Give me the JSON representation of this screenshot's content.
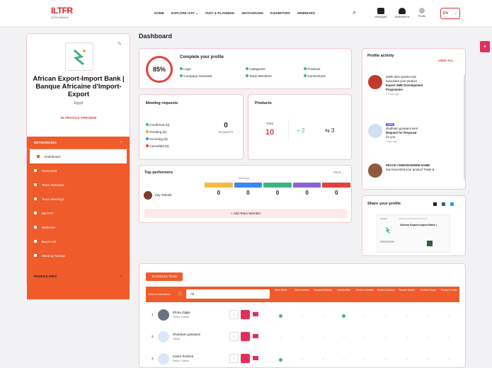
{
  "topbar": {
    "logo_text": "ILTFR",
    "logo_sub": "AFREXIMBANK",
    "nav": [
      "HOME",
      "EXPLORE IATF",
      "VISIT & PLANNING",
      "INSTAGRAMS",
      "EXHIBITORS",
      "WEBINARS"
    ],
    "nav_dropdown_index": 1,
    "icons": [
      {
        "label": "Messages"
      },
      {
        "label": "Notifications"
      },
      {
        "label": "Profile"
      }
    ],
    "lang": "EN"
  },
  "sidebar": {
    "org_name": "African Export-Import Bank | Banque Africaine d'Import-Export",
    "org_country": "Egypt",
    "preview_link": "IN PROFILE PREVIEW",
    "section_label": "NETWORKING",
    "menu": [
      "Dashboard",
      "Favourites",
      "Team Schedule",
      "Team Meetings",
      "My RFP",
      "Webinars",
      "Buyer List",
      "Meeting Ratings"
    ],
    "profile_info": "PROFILE INFO"
  },
  "main": {
    "title": "Dashboard",
    "profile": {
      "percent": "85%",
      "title": "Complete your profile",
      "items": [
        "Logo",
        "Company Overview",
        "Categories",
        "Team Members",
        "Products",
        "Connections"
      ]
    },
    "meetings": {
      "title": "Meeting requests",
      "items": [
        {
          "label": "Confirmed (0)",
          "color": "#3bb77e"
        },
        {
          "label": "Pending (0)",
          "color": "#f2a33a"
        },
        {
          "label": "Incoming (0)",
          "color": "#3a86f2"
        },
        {
          "label": "Cancelled (0)",
          "color": "#e2433a"
        }
      ],
      "count": "0",
      "count_label": "REQUESTS"
    },
    "products": {
      "title": "Products",
      "total_label": "Total",
      "total": "10",
      "a": "2",
      "b": "3"
    },
    "performers": {
      "title": "Top performers",
      "filter": "Week",
      "meetings_label": "Meetings",
      "person": "Kay Yeboah",
      "values": [
        "0",
        "0",
        "0",
        "0",
        "0"
      ],
      "tag_colors": [
        "#f5b942",
        "#3a86f2",
        "#3bb77e",
        "#8a63d2",
        "#e2433a"
      ],
      "add_button": "+ Add Team Member"
    },
    "activity": {
      "title": "Profile activity",
      "view_all": "VIEW ALL",
      "entries": [
        {
          "line1": "tebife aloe iyambo has",
          "line2": "favourited your product",
          "bold": "Export SME Development Programme",
          "time": "2 hours ago",
          "avatar": "#c0392b"
        },
        {
          "badge": "NEW",
          "line1": "shubham goswami sent",
          "line2": "",
          "bold": "Request for Proposal",
          "extra": "for you",
          "time": "a day ago",
          "avatar": "#cfe0f5"
        },
        {
          "line1": "",
          "line2": "",
          "bold": "PEACE CHINONYEREM NAME",
          "extra": "has favourited your product Trade &",
          "time": "",
          "avatar": "#8e5a3c"
        }
      ]
    },
    "share": {
      "title": "Share your profile",
      "card_title": "African Export-Import Bank |"
    },
    "team": {
      "tab": "SCHEDULE TEAM",
      "search_label": "Search members",
      "search_value": "All",
      "cols": [
        "Meet Client",
        "Meet Investor",
        "Request Meeting",
        "Instant Offer",
        "Review Activities",
        "Review Updates",
        "Review Events",
        "Contact Group",
        "Contact Centre"
      ],
      "rows": [
        {
          "num": "1",
          "name": "Efosa Ojigie",
          "role": "Visitor, Admin",
          "marks": [
            1,
            0,
            0,
            1,
            0,
            0,
            0,
            0,
            0
          ]
        },
        {
          "num": "2",
          "name": "Shubham goswami",
          "role": "Visitor",
          "marks": [
            0,
            0,
            0,
            0,
            0,
            0,
            0,
            0,
            0
          ]
        },
        {
          "num": "3",
          "name": "Karen Rodrick",
          "role": "Visitor, Admin",
          "marks": [
            1,
            0,
            0,
            0,
            0,
            0,
            0,
            0,
            0
          ]
        }
      ]
    }
  }
}
